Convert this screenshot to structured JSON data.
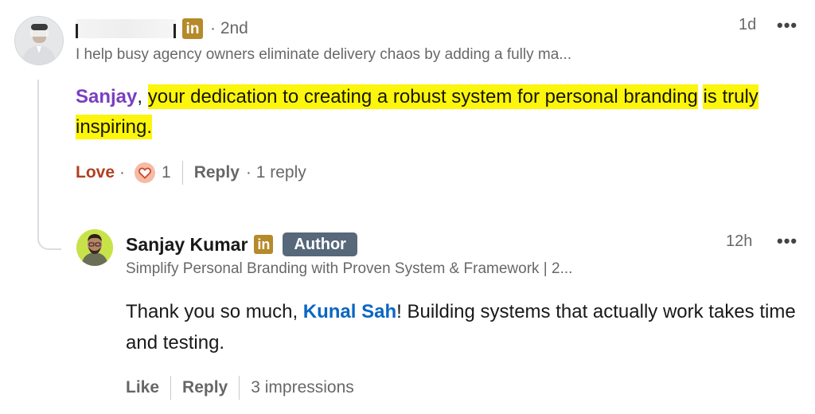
{
  "top_comment": {
    "author_name": "",
    "degree": "· 2nd",
    "time": "1d",
    "more": "•••",
    "headline": "I help busy agency owners eliminate delivery chaos by adding a fully ma...",
    "mention": "Sanjay",
    "comma": ",",
    "text_highlight_1": "your dedication to creating a robust system for personal branding",
    "text_highlight_2": "is truly inspiring.",
    "reaction_label": "Love",
    "reaction_dot": "·",
    "reaction_count": "1",
    "reply_label": "Reply",
    "replies_count": "· 1 reply"
  },
  "reply": {
    "author_name": "Sanjay Kumar",
    "author_badge": "Author",
    "time": "12h",
    "more": "•••",
    "headline": "Simplify Personal Branding with Proven System & Framework | 2...",
    "text_before": "Thank you so much, ",
    "mention": "Kunal Sah",
    "text_after": "! Building systems that actually work takes time and testing.",
    "like_label": "Like",
    "reply_label": "Reply",
    "impressions": "3 impressions"
  },
  "icons": {
    "linkedin": "in",
    "reaction": "heart-icon"
  },
  "colors": {
    "linkedin_badge": "#b58a2a",
    "highlight": "#fcf50c",
    "mention_purple": "#7a3fc0",
    "mention_blue": "#0a66c2",
    "love": "#b24020",
    "author_badge": "#56687a"
  }
}
